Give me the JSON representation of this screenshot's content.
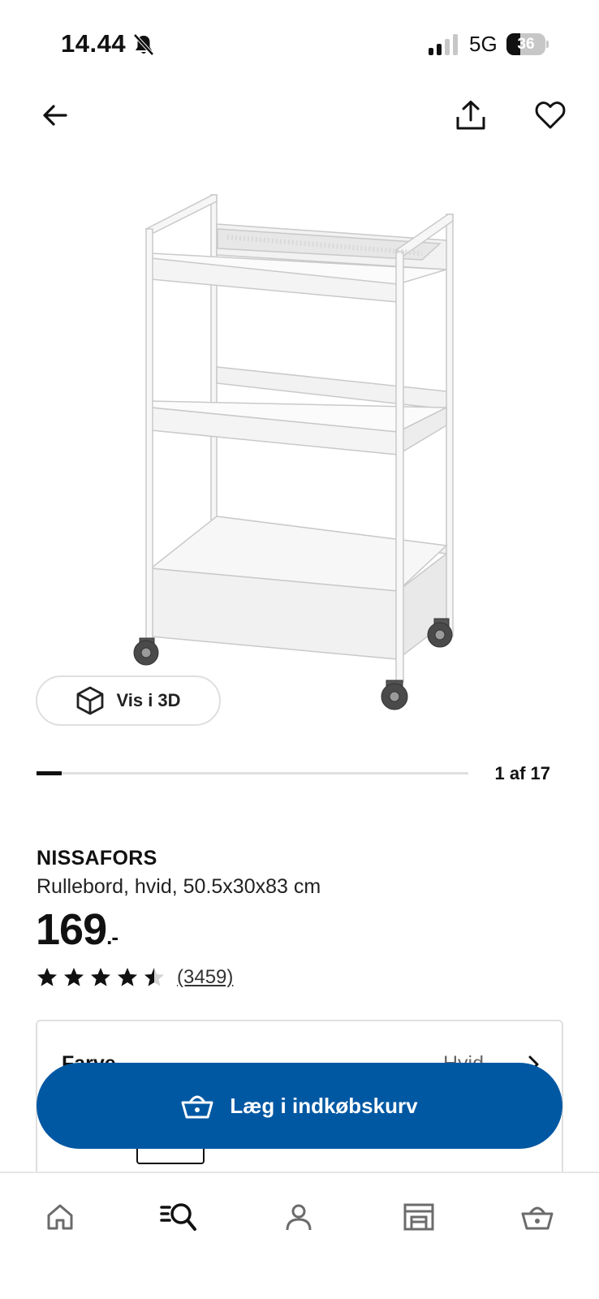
{
  "status_bar": {
    "time": "14.44",
    "network": "5G",
    "battery": "36",
    "battery_level": 0.36
  },
  "product": {
    "name": "NISSAFORS",
    "description": "Rullebord, hvid, 50.5x30x83 cm",
    "price": "169",
    "price_suffix": ".-",
    "rating": 4.5,
    "review_count": "(3459)"
  },
  "gallery": {
    "view_3d_label": "Vis i 3D",
    "counter": "1 af 17",
    "current": 1,
    "total": 17
  },
  "variant": {
    "label": "Farve",
    "value": "Hvid"
  },
  "cart": {
    "add_label": "Læg i indkøbskurv"
  },
  "colors": {
    "primary_button": "#0058a3",
    "text": "#111111",
    "muted": "#666666"
  },
  "icons": {
    "back": "arrow-left-icon",
    "share": "share-icon",
    "favorite": "heart-icon",
    "view_3d": "cube-icon",
    "cart": "basket-icon",
    "nav": [
      "home-icon",
      "search-icon",
      "profile-icon",
      "store-icon",
      "basket-icon"
    ]
  }
}
